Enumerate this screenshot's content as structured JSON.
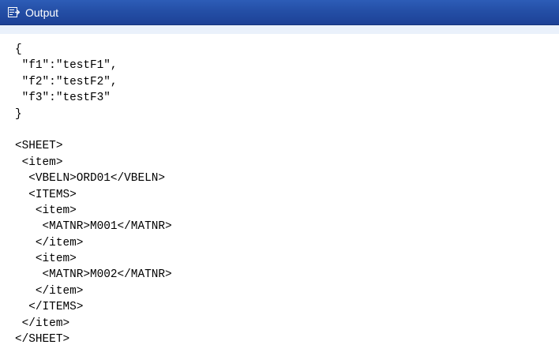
{
  "window": {
    "title": "Output",
    "title_icon": "output-window-icon"
  },
  "output": {
    "lines": [
      "{",
      " \"f1\":\"testF1\",",
      " \"f2\":\"testF2\",",
      " \"f3\":\"testF3\"",
      "}",
      "",
      "<SHEET>",
      " <item>",
      "  <VBELN>ORD01</VBELN>",
      "  <ITEMS>",
      "   <item>",
      "    <MATNR>M001</MATNR>",
      "   </item>",
      "   <item>",
      "    <MATNR>M002</MATNR>",
      "   </item>",
      "  </ITEMS>",
      " </item>",
      "</SHEET>"
    ]
  },
  "colors": {
    "titlebar": "#244fa6",
    "titlebar_text": "#ffffff",
    "strip": "#eaf1fb",
    "content_bg": "#ffffff",
    "text": "#000000"
  }
}
